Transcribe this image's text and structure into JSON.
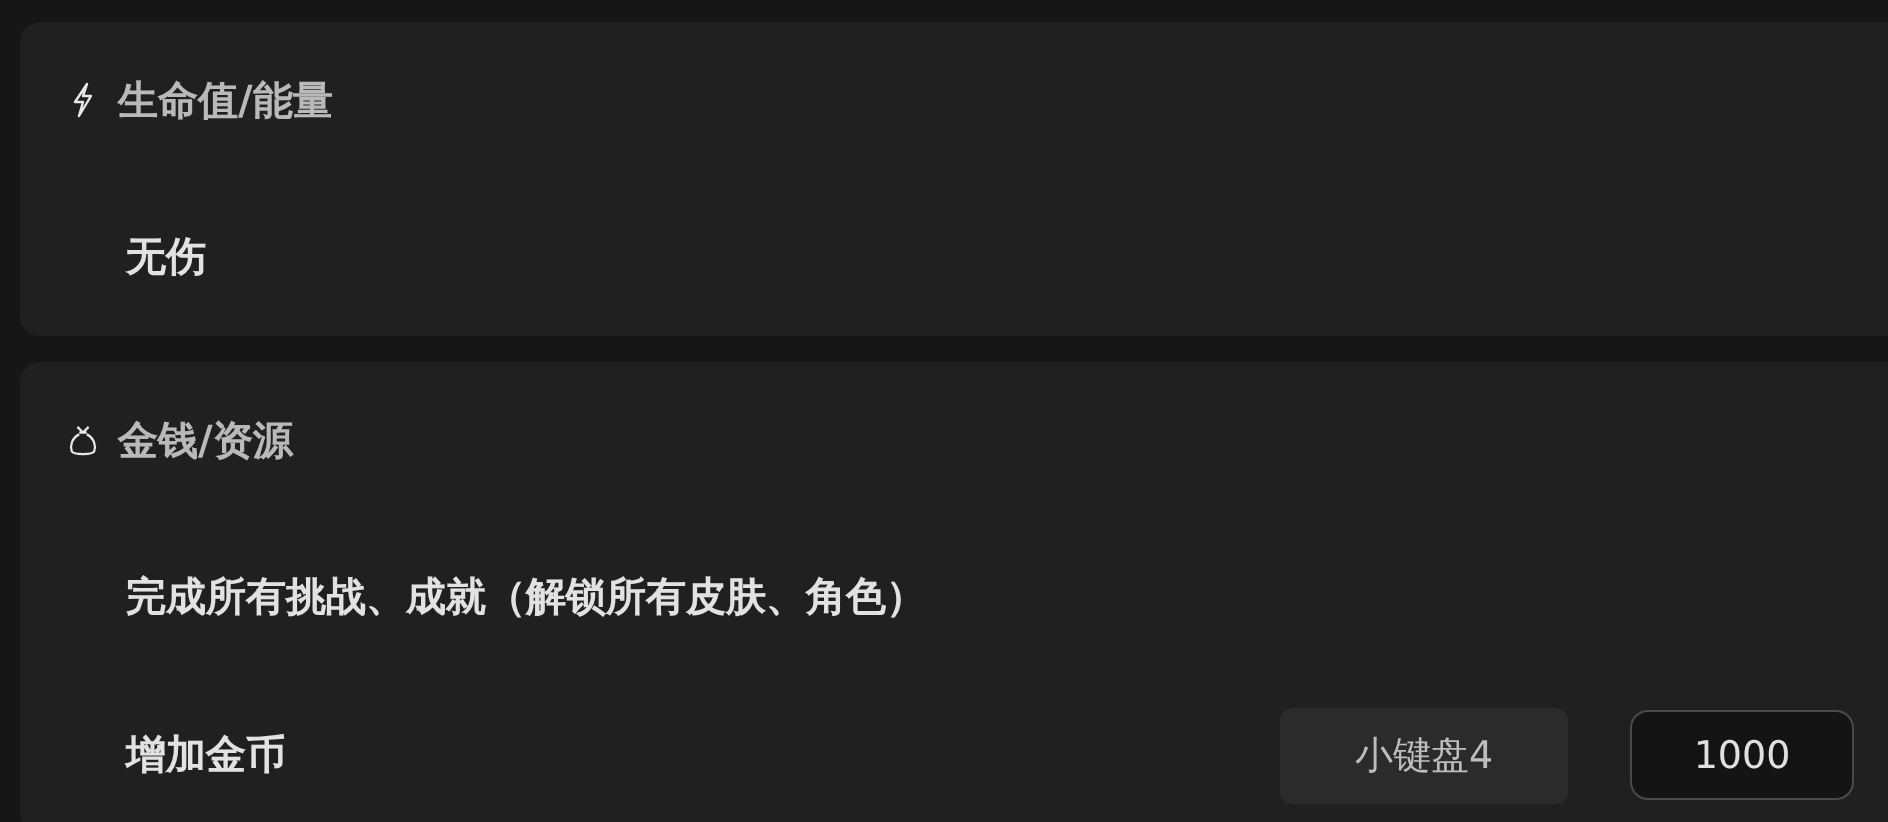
{
  "sections": [
    {
      "kind": "health",
      "title": "生命值/能量",
      "items": [
        {
          "kind": "plain",
          "label": "无伤"
        }
      ]
    },
    {
      "kind": "money",
      "title": "金钱/资源",
      "items": [
        {
          "kind": "plain",
          "label": "完成所有挑战、成就（解锁所有皮肤、角色）"
        },
        {
          "kind": "input",
          "label": "增加金币",
          "hotkey": "小键盘4",
          "value": "1000"
        }
      ]
    }
  ]
}
